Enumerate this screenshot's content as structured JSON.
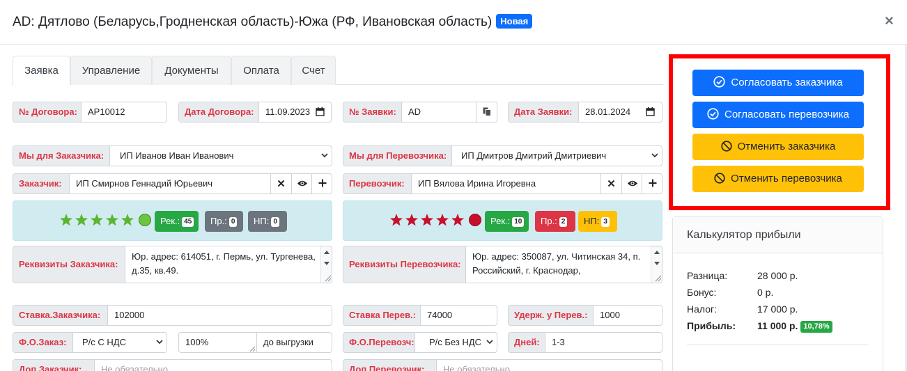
{
  "modal": {
    "title": "AD: Дятлово (Беларусь,Гродненская область)-Южа (РФ, Ивановская область)",
    "badge": "Новая",
    "close": "×"
  },
  "tabs": [
    "Заявка",
    "Управление",
    "Документы",
    "Оплата",
    "Счет"
  ],
  "contract": {
    "num_label": "№ Договора:",
    "num_value": "AP10012",
    "date_label": "Дата Договора:",
    "date_value": "11.09.2023",
    "req_label": "№ Заявки:",
    "req_value": "AD",
    "req_date_label": "Дата Заявки:",
    "req_date_value": "28.01.2024"
  },
  "customer": {
    "we_label": "Мы для Заказчика:",
    "we_value": "ИП Иванов Иван Иванович",
    "label": "Заказчик:",
    "value": "ИП Смирнов Геннадий Юрьевич",
    "rec_label": "Рек.:",
    "rec_count": "45",
    "pr_label": "Пр.:",
    "pr_count": "0",
    "np_label": "НП:",
    "np_count": "0",
    "details_label": "Реквизиты Заказчика:",
    "details_line1": "Юр. адрес: 614051, г. Пермь, ул. Тургенева,",
    "details_line2": "д.35, кв.49.",
    "rate_label": "Ставка.Заказчика:",
    "rate_value": "102000",
    "payform_label": "Ф.О.Заказ:",
    "payform_value": "Р/с С НДС",
    "percent_value": "100%",
    "unload_value": "до выгрузки",
    "extra_label": "Доп.Заказчик:",
    "extra_placeholder": "Не обязательно"
  },
  "carrier": {
    "we_label": "Мы для Перевозчика:",
    "we_value": "ИП Дмитров Дмитрий Дмитриевич",
    "label": "Перевозчик:",
    "value": "ИП Вялова Ирина Игоревна",
    "rec_label": "Рек.:",
    "rec_count": "10",
    "pr_label": "Пр.:",
    "pr_count": "2",
    "np_label": "НП:",
    "np_count": "3",
    "details_label": "Реквизиты Перевозчика:",
    "details_line1": "Юр. адрес: 350087, ул. Читинская 34, п.",
    "details_line2": "Российский, г. Краснодар,",
    "rate_label": "Ставка Перев.:",
    "rate_value": "74000",
    "hold_label": "Удерж. у Перев.:",
    "hold_value": "1000",
    "payform_label": "Ф.О.Перевозч:",
    "payform_value": "Р/с Без НДС",
    "days_label": "Дней:",
    "days_value": "1-3",
    "extra_label": "Доп.Перевозчик:",
    "extra_placeholder": "Не обязательно"
  },
  "actions": {
    "approve_customer": "Согласовать заказчика",
    "approve_carrier": "Согласовать перевозчика",
    "cancel_customer": "Отменить заказчика",
    "cancel_carrier": "Отменить перевозчика"
  },
  "calculator": {
    "title": "Калькулятор прибыли",
    "rows": [
      {
        "label": "Разница:",
        "value": "28 000 р."
      },
      {
        "label": "Бонус:",
        "value": "0 р."
      },
      {
        "label": "Налог:",
        "value": "17 000 р."
      }
    ],
    "profit_label": "Прибыль:",
    "profit_value": "11 000 р.",
    "profit_pct": "10,78%"
  },
  "colors": {
    "accent_blue": "#0d6efd",
    "amber": "#ffc107",
    "highlight": "#ff0000",
    "label_red": "#dc3545",
    "star_green": "#5cb531",
    "star_red": "#c8102e"
  },
  "ratings": {
    "customer_stars": 5,
    "carrier_stars": 5
  }
}
